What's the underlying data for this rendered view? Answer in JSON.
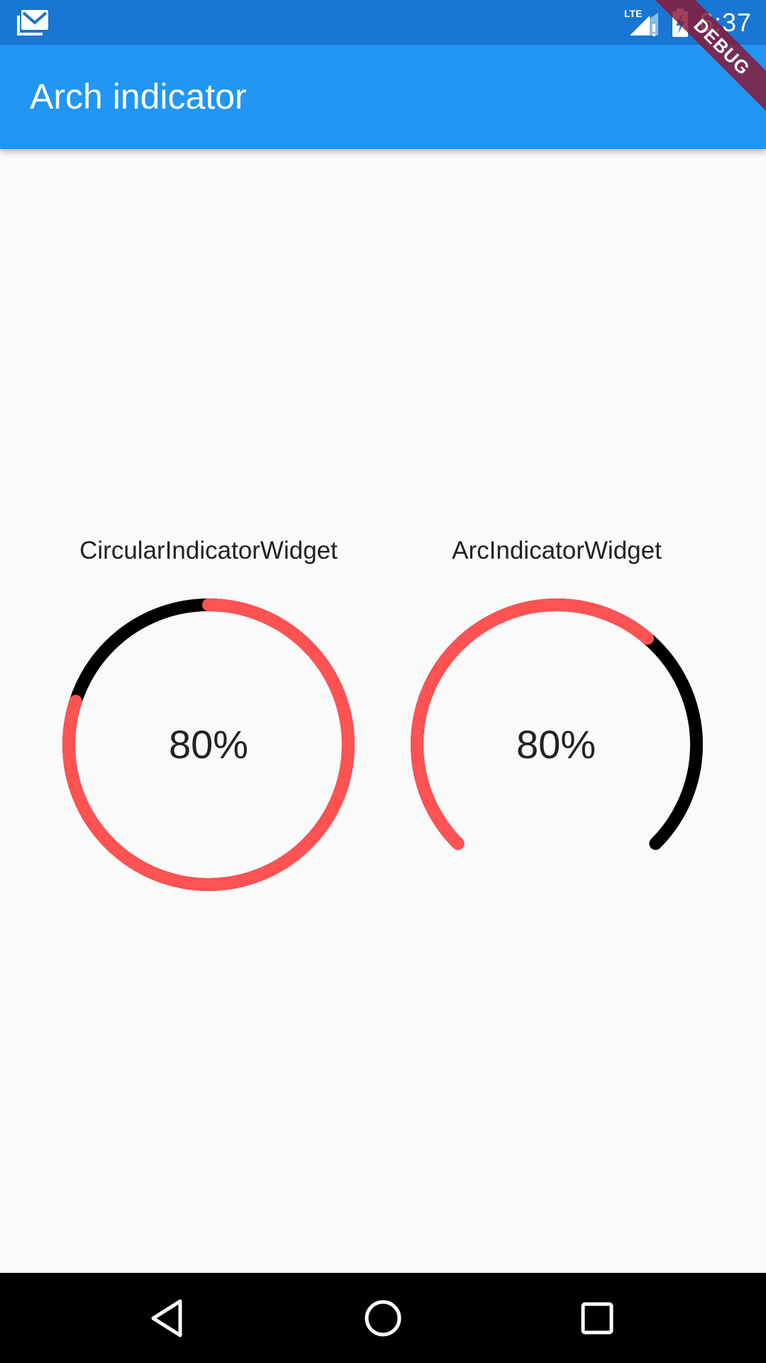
{
  "status_bar": {
    "time": "6:37",
    "network": "LTE",
    "icons": [
      "gmail-icon",
      "lte-signal-icon",
      "battery-charging-icon"
    ]
  },
  "app_bar": {
    "title": "Arch indicator"
  },
  "debug_banner": {
    "label": "DEBUG",
    "color": "#8a1633"
  },
  "widgets": [
    {
      "label": "CircularIndicatorWidget",
      "percent_text": "80%",
      "progress": 0.8,
      "progress_color": "#ff5252",
      "track_color": "#000000"
    },
    {
      "label": "ArcIndicatorWidget",
      "percent_text": "80%",
      "progress": 0.8,
      "progress_color": "#ff5252",
      "track_color": "#000000"
    }
  ],
  "nav_bar": {
    "icons": [
      "back-icon",
      "home-icon",
      "recents-icon"
    ]
  },
  "colors": {
    "status_bar": "#1976d2",
    "app_bar": "#2196f3",
    "background": "#fafafa"
  }
}
